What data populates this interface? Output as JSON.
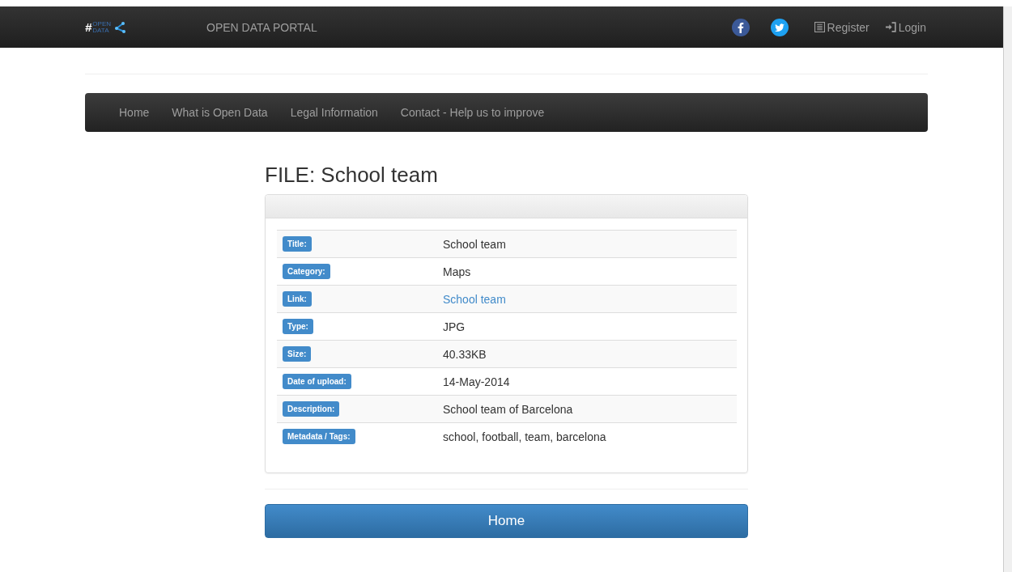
{
  "topbar": {
    "logo_mark": "#",
    "logo_words": "OPEN DATA",
    "title": "OPEN DATA PORTAL",
    "links": [
      {
        "kind": "register",
        "label": "Register"
      },
      {
        "kind": "login",
        "label": "Login"
      }
    ]
  },
  "nav": {
    "items": [
      "Home",
      "What is Open Data",
      "Legal Information",
      "Contact - Help us to improve"
    ]
  },
  "page_title": "FILE: School team",
  "details": [
    {
      "label": "Title:",
      "value": "School team",
      "kind": "text"
    },
    {
      "label": "Category:",
      "value": "Maps",
      "kind": "text"
    },
    {
      "label": "Link:",
      "value": "School team",
      "kind": "link"
    },
    {
      "label": "Type:",
      "value": "JPG",
      "kind": "text"
    },
    {
      "label": "Size:",
      "value": "40.33KB",
      "kind": "text"
    },
    {
      "label": "Date of upload:",
      "value": "14-May-2014",
      "kind": "text"
    },
    {
      "label": "Description:",
      "value": "School team of Barcelona",
      "kind": "text"
    },
    {
      "label": "Metadata / Tags:",
      "value": "school, football, team, barcelona",
      "kind": "text"
    }
  ],
  "home_button": "Home"
}
